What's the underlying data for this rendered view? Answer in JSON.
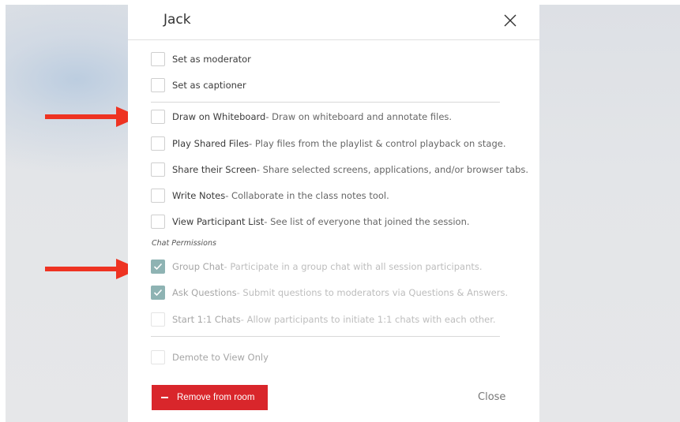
{
  "modal": {
    "title": "Jack",
    "close_icon": "close-x-icon"
  },
  "roles": [
    {
      "label": "Set as moderator",
      "checked": false
    },
    {
      "label": "Set as captioner",
      "checked": false
    }
  ],
  "permissions": [
    {
      "label": "Draw on Whiteboard",
      "description": " - Draw on whiteboard and annotate files.",
      "checked": false
    },
    {
      "label": "Play Shared Files",
      "description": " - Play files from the playlist & control playback on stage.",
      "checked": false
    },
    {
      "label": "Share their Screen",
      "description": " - Share selected screens, applications, and/or browser tabs.",
      "checked": false
    },
    {
      "label": "Write Notes",
      "description": " - Collaborate in the class notes tool.",
      "checked": false
    },
    {
      "label": "View Participant List",
      "description": " - See list of everyone that joined the session.",
      "checked": false
    }
  ],
  "chat_permissions": {
    "heading": "Chat Permissions",
    "items": [
      {
        "label": "Group Chat",
        "description": " - Participate in a group chat with all session participants.",
        "checked": true
      },
      {
        "label": "Ask Questions",
        "description": " - Submit questions to moderators via Questions & Answers.",
        "checked": true
      },
      {
        "label": "Start 1:1 Chats",
        "description": " - Allow participants to initiate 1:1 chats with each other.",
        "checked": false
      }
    ]
  },
  "demote": {
    "label": "Demote to View Only",
    "checked": false
  },
  "footer": {
    "remove_label": "Remove from room",
    "close_label": "Close"
  },
  "colors": {
    "accent_red": "#d9262b",
    "checkbox_checked": "#8eb3b3",
    "annotation_arrow": "#ee3322"
  }
}
